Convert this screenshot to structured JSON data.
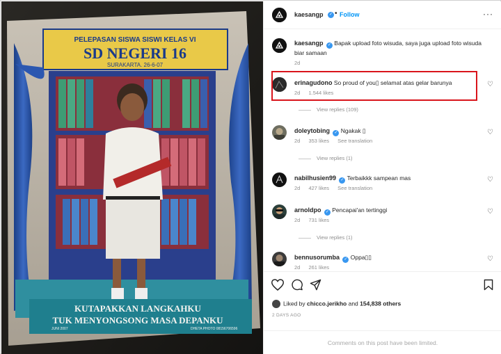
{
  "post": {
    "username": "kaesangp",
    "follow_label": "Follow",
    "more_label": "···"
  },
  "photo": {
    "banner_line1": "PELEPASAN SISWA SISWI KELAS VI",
    "banner_line2": "SD NEGERI 16",
    "banner_line3": "SURAKARTA. 26-6-07",
    "caption_line1": "KUTAPAKKAN LANGKAHKU",
    "caption_line2": "TUK MENYONGSONG MASA DEPANKU",
    "small_left": "JUNI 2007",
    "small_right": "DHETA PHOTO 08156706596"
  },
  "comments": [
    {
      "username": "kaesangp",
      "verified": true,
      "text": "Bapak upload foto wisuda, saya juga upload foto wisuda biar samaan",
      "time": "2d"
    },
    {
      "username": "erinagudono",
      "verified": false,
      "text": "So proud of you▯ selamat atas gelar barunya",
      "time": "2d",
      "likes": "1.544 likes",
      "view_replies": "View replies (109)"
    },
    {
      "username": "doleytobing",
      "verified": true,
      "text": "Ngakak ▯",
      "time": "2d",
      "likes": "353 likes",
      "translation": "See translation",
      "view_replies": "View replies (1)"
    },
    {
      "username": "nabilhusien99",
      "verified": true,
      "text": "Terbaikkk sampean mas",
      "time": "2d",
      "likes": "427 likes",
      "translation": "See translation"
    },
    {
      "username": "arnoldpo",
      "verified": true,
      "text": "Pencapai'an tertinggi",
      "time": "2d",
      "likes": "731 likes",
      "view_replies": "View replies (1)"
    },
    {
      "username": "bennusorumba",
      "verified": true,
      "text": "Oppa▯▯",
      "time": "2d",
      "likes": "261 likes"
    }
  ],
  "actions": {
    "icons": [
      "heart-icon",
      "comment-icon",
      "share-icon",
      "bookmark-icon"
    ],
    "liked_prefix": "Liked by",
    "liked_user": "chicco.jerikho",
    "liked_and": "and",
    "liked_count": "154,838 others",
    "timestamp": "2 DAYS AGO",
    "limited": "Comments on this post have been limited."
  },
  "colors": {
    "link_blue": "#0095f6",
    "verified_blue": "#3897f0",
    "highlight_red": "#d9141b",
    "muted_gray": "#8e8e8e"
  }
}
